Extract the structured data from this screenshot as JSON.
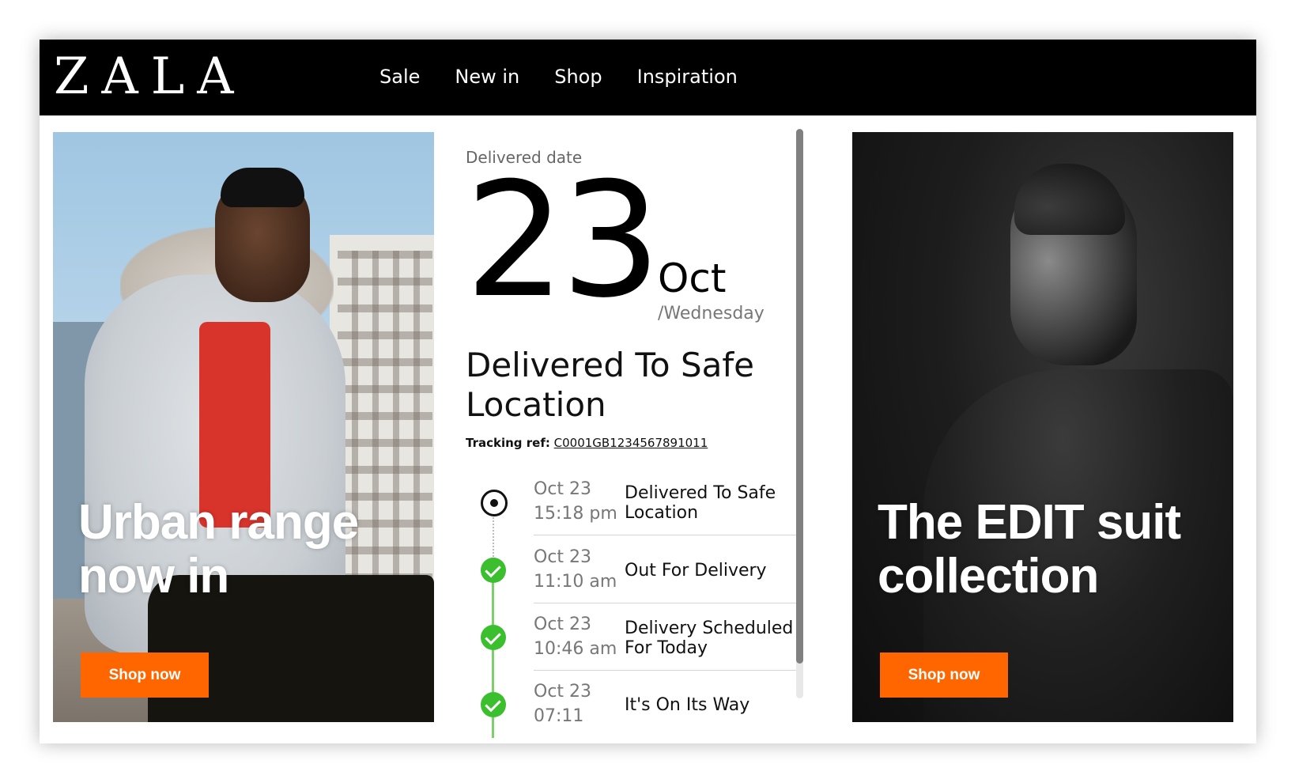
{
  "header": {
    "logo": "ZALA",
    "nav": [
      "Sale",
      "New in",
      "Shop",
      "Inspiration"
    ]
  },
  "promo_left": {
    "title_line1": "Urban range",
    "title_line2": "now in",
    "button": "Shop now"
  },
  "promo_right": {
    "title_line1": "The EDIT suit",
    "title_line2": "collection",
    "button": "Shop now"
  },
  "delivery": {
    "label": "Delivered date",
    "day": "23",
    "month": "Oct",
    "weekday": "/Wednesday",
    "status": "Delivered To Safe Location",
    "tracking_label": "Tracking ref:",
    "tracking_ref": "C0001GB1234567891011"
  },
  "timeline": [
    {
      "date": "Oct 23",
      "time": "15:18 pm",
      "desc": "Delivered To Safe Location",
      "state": "current"
    },
    {
      "date": "Oct 23",
      "time": "11:10 am",
      "desc": "Out For Delivery",
      "state": "done"
    },
    {
      "date": "Oct 23",
      "time": "10:46 am",
      "desc": "Delivery Scheduled For Today",
      "state": "done"
    },
    {
      "date": "Oct 23",
      "time": "07:11",
      "desc": "It's On Its Way",
      "state": "done"
    }
  ],
  "colors": {
    "accent": "#ff6600",
    "header_bg": "#000000",
    "check_green": "#3cbf2f",
    "line_green": "#7bd06a"
  }
}
